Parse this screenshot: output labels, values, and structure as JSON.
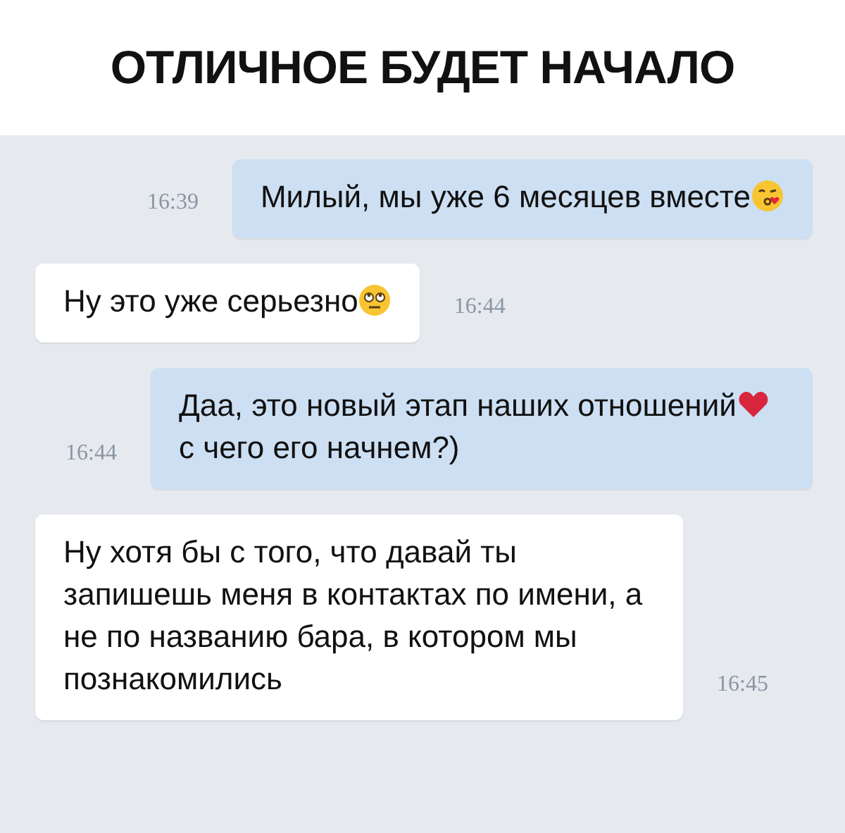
{
  "title": "ОТЛИЧНОЕ БУДЕТ НАЧАЛО",
  "messages": [
    {
      "kind": "outgoing",
      "time": "16:39",
      "segments": [
        {
          "kind": "text",
          "text": "Милый, мы уже 6 месяцев вместе"
        },
        {
          "kind": "face"
        }
      ]
    },
    {
      "kind": "incoming",
      "time": "16:44",
      "segments": [
        {
          "kind": "text",
          "text": "Ну это  уже серьезно"
        },
        {
          "kind": "face"
        }
      ]
    },
    {
      "kind": "outgoing",
      "time": "16:44",
      "segments": [
        {
          "kind": "text",
          "text": "Даа, это новый этап наших отношений"
        },
        {
          "kind": "heart"
        },
        {
          "kind": "text",
          "text": " с чего его начнем?)"
        }
      ]
    },
    {
      "kind": "incoming",
      "time": "16:45",
      "segments": [
        {
          "kind": "text",
          "text": "Ну хотя бы с того, что давай ты запишешь меня в контактах по имени, а не по названию бара, в котором мы познакомились"
        }
      ]
    }
  ]
}
